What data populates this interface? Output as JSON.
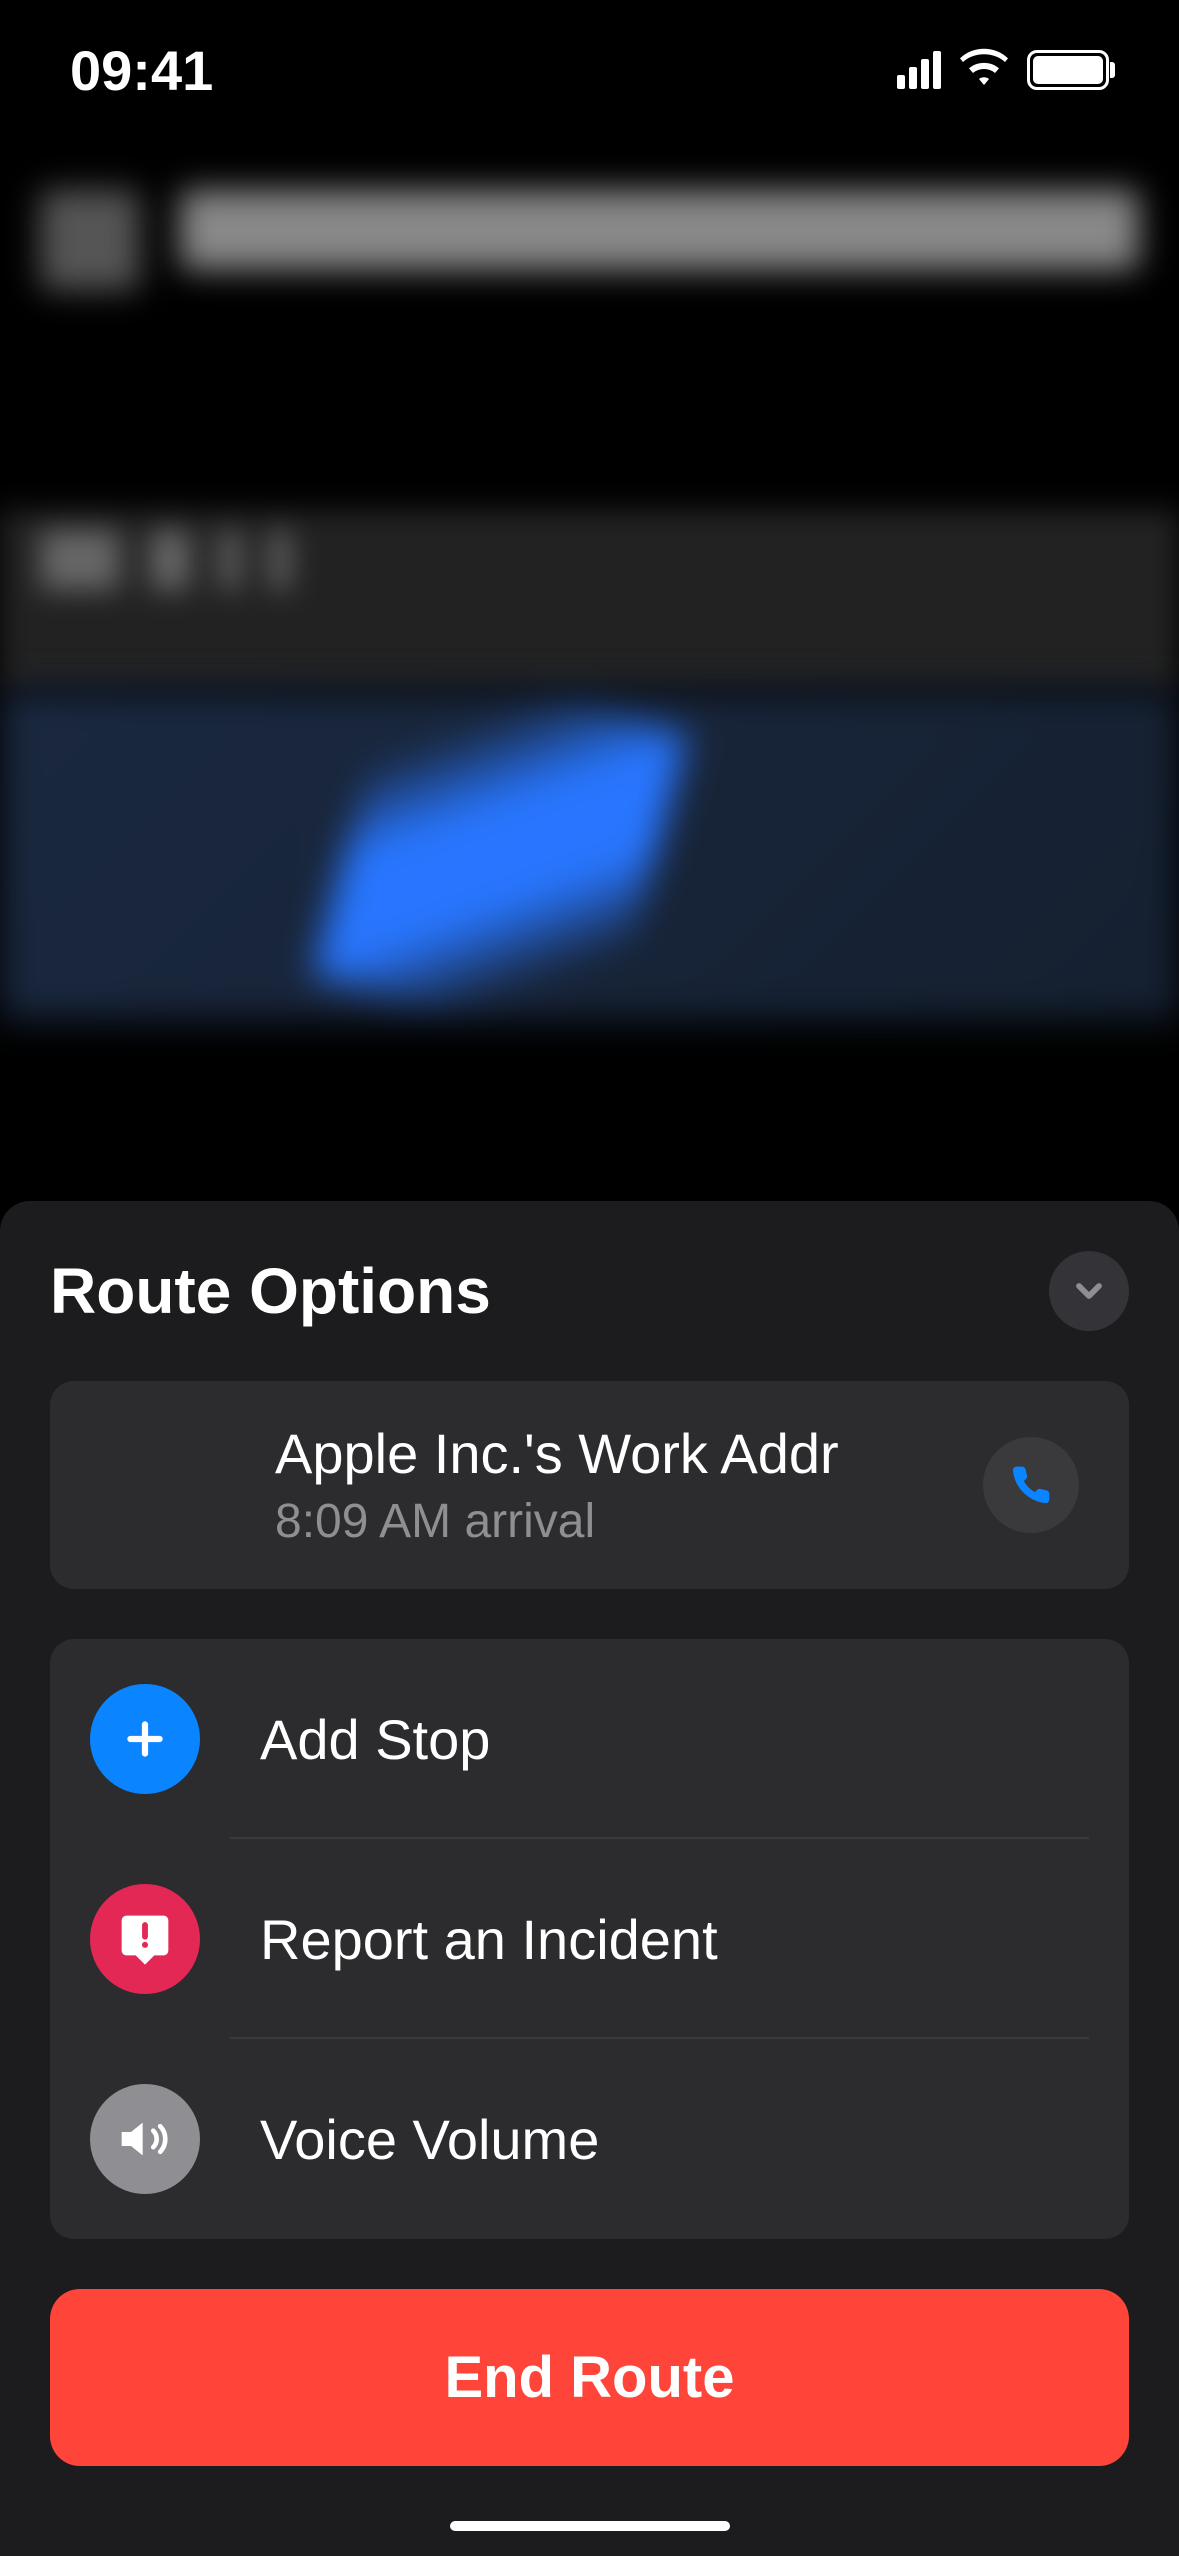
{
  "status_bar": {
    "time": "09:41"
  },
  "sheet": {
    "title": "Route Options",
    "destination": {
      "name": "Apple Inc.'s Work Addr",
      "eta": "8:09 AM arrival"
    },
    "options": [
      {
        "label": "Add Stop",
        "icon_color": "blue"
      },
      {
        "label": "Report an Incident",
        "icon_color": "red"
      },
      {
        "label": "Voice Volume",
        "icon_color": "gray"
      }
    ],
    "end_route_label": "End Route"
  }
}
